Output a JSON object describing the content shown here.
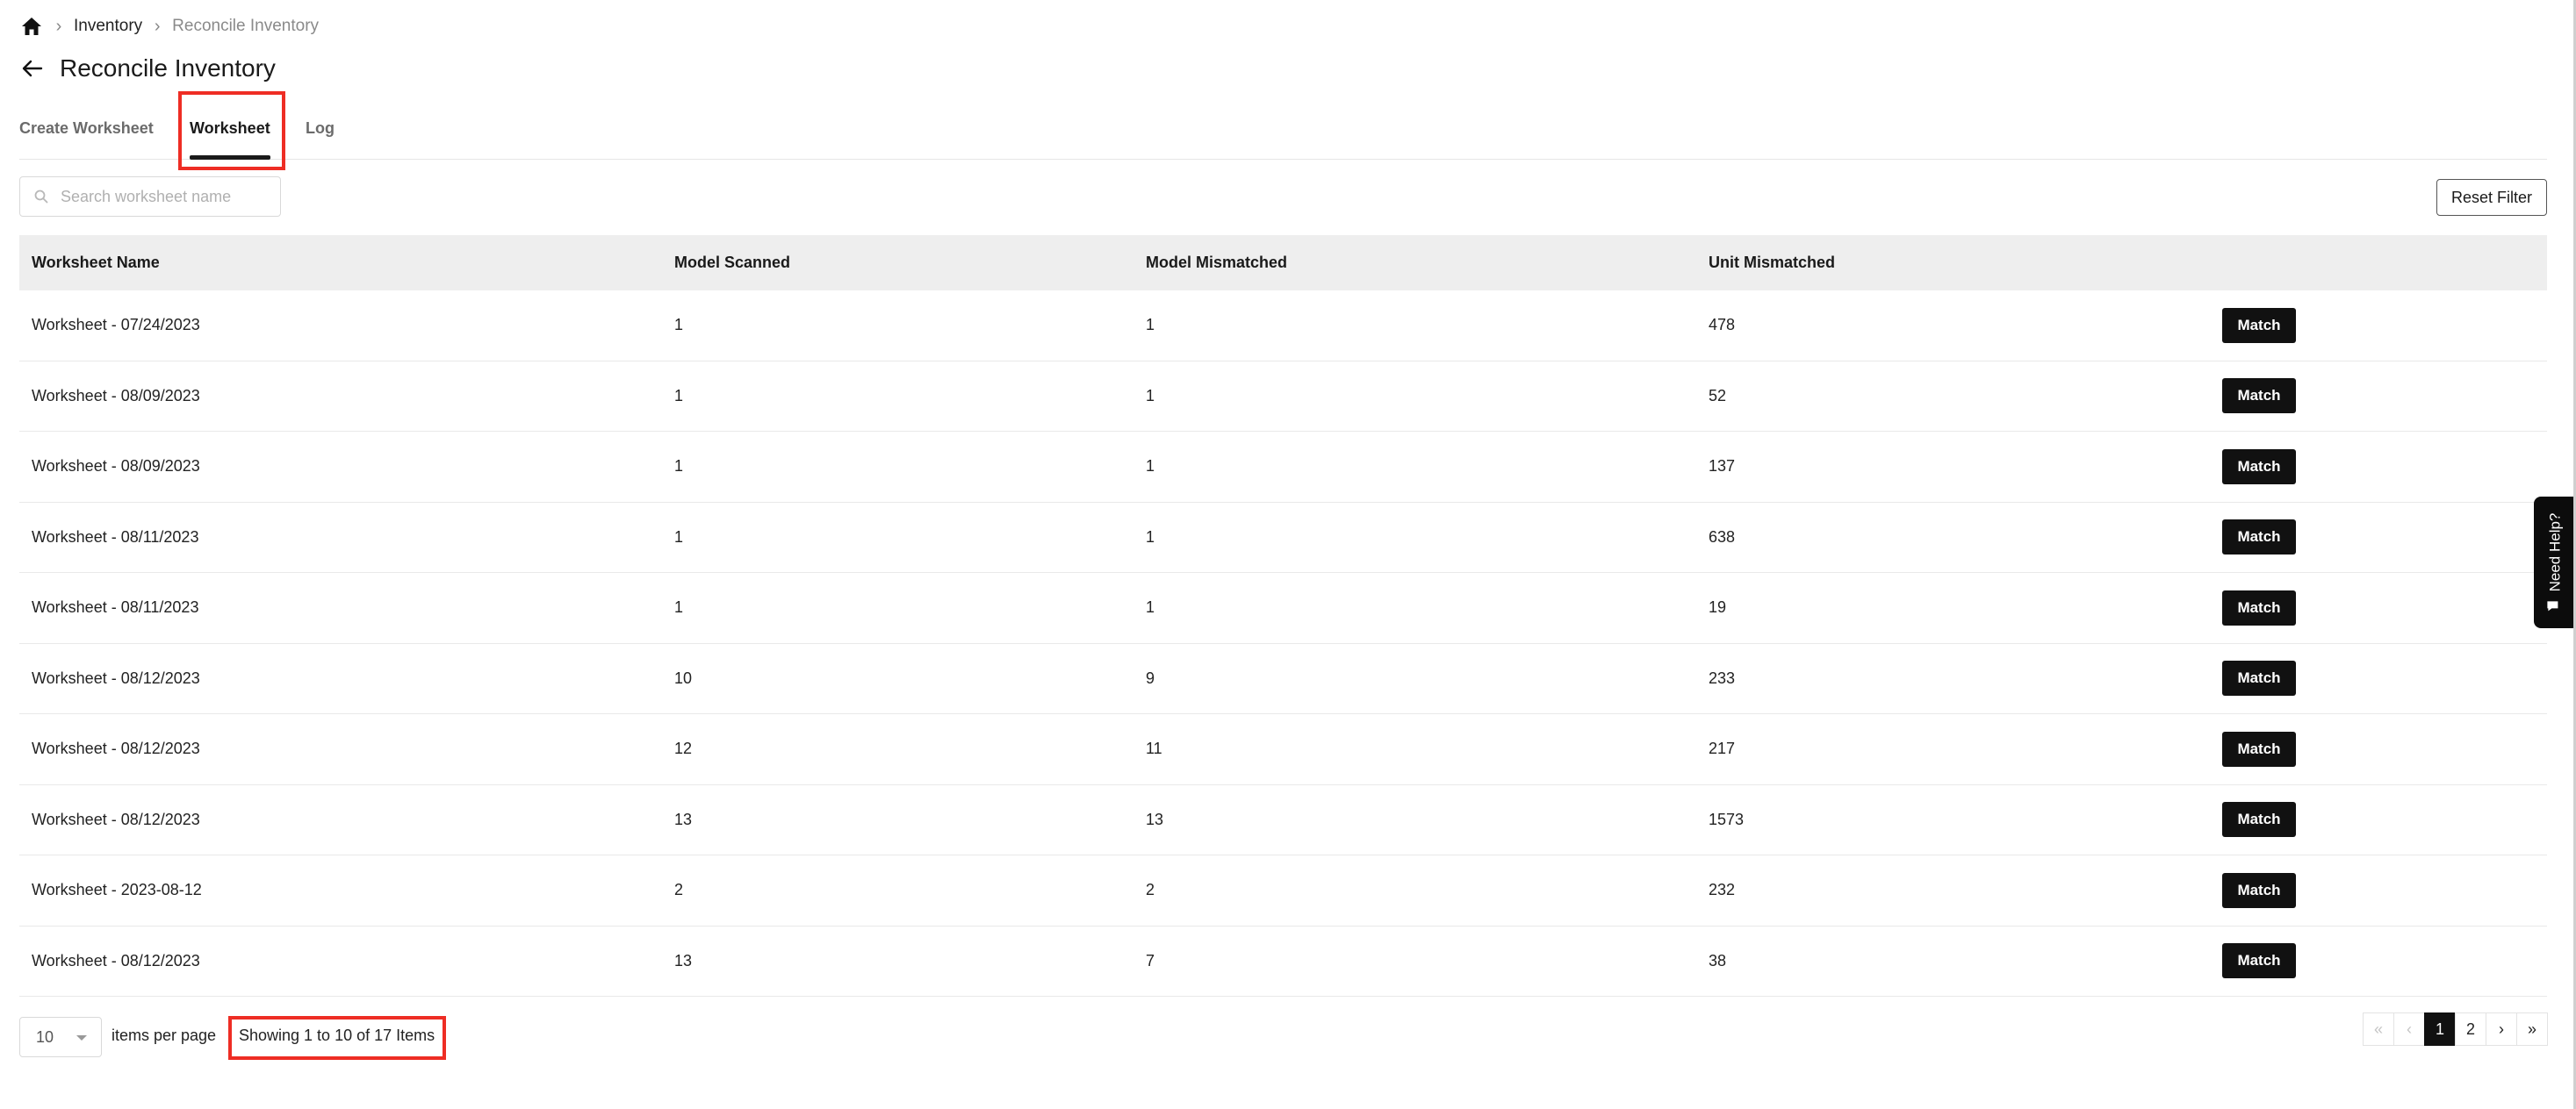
{
  "breadcrumb": {
    "home_icon": "home-icon",
    "items": [
      "Inventory",
      "Reconcile Inventory"
    ]
  },
  "page": {
    "title": "Reconcile Inventory"
  },
  "tabs": [
    {
      "label": "Create Worksheet",
      "active": false
    },
    {
      "label": "Worksheet",
      "active": true
    },
    {
      "label": "Log",
      "active": false
    }
  ],
  "search": {
    "placeholder": "Search worksheet name",
    "value": ""
  },
  "toolbar": {
    "reset_label": "Reset Filter"
  },
  "table": {
    "headers": [
      "Worksheet Name",
      "Model Scanned",
      "Model Mismatched",
      "Unit Mismatched",
      ""
    ],
    "action_label": "Match",
    "rows": [
      {
        "name": "Worksheet - 07/24/2023",
        "model_scanned": "1",
        "model_mismatched": "1",
        "unit_mismatched": "478"
      },
      {
        "name": "Worksheet - 08/09/2023",
        "model_scanned": "1",
        "model_mismatched": "1",
        "unit_mismatched": "52"
      },
      {
        "name": "Worksheet - 08/09/2023",
        "model_scanned": "1",
        "model_mismatched": "1",
        "unit_mismatched": "137"
      },
      {
        "name": "Worksheet - 08/11/2023",
        "model_scanned": "1",
        "model_mismatched": "1",
        "unit_mismatched": "638"
      },
      {
        "name": "Worksheet - 08/11/2023",
        "model_scanned": "1",
        "model_mismatched": "1",
        "unit_mismatched": "19"
      },
      {
        "name": "Worksheet - 08/12/2023",
        "model_scanned": "10",
        "model_mismatched": "9",
        "unit_mismatched": "233"
      },
      {
        "name": "Worksheet - 08/12/2023",
        "model_scanned": "12",
        "model_mismatched": "11",
        "unit_mismatched": "217"
      },
      {
        "name": "Worksheet - 08/12/2023",
        "model_scanned": "13",
        "model_mismatched": "13",
        "unit_mismatched": "1573"
      },
      {
        "name": "Worksheet - 2023-08-12",
        "model_scanned": "2",
        "model_mismatched": "2",
        "unit_mismatched": "232"
      },
      {
        "name": "Worksheet - 08/12/2023",
        "model_scanned": "13",
        "model_mismatched": "7",
        "unit_mismatched": "38"
      }
    ]
  },
  "pagination": {
    "per_page_value": "10",
    "per_page_label": "items per page",
    "showing_text": "Showing 1 to 10 of 17 Items",
    "buttons": [
      {
        "label": "«",
        "state": "disabled"
      },
      {
        "label": "‹",
        "state": "disabled"
      },
      {
        "label": "1",
        "state": "active"
      },
      {
        "label": "2",
        "state": "normal"
      },
      {
        "label": "›",
        "state": "normal"
      },
      {
        "label": "»",
        "state": "normal"
      }
    ]
  },
  "help": {
    "label": "Need Help?",
    "icon": "chat-bubble-icon"
  },
  "colors": {
    "highlight": "#ee2d24",
    "button_dark": "#111111"
  }
}
